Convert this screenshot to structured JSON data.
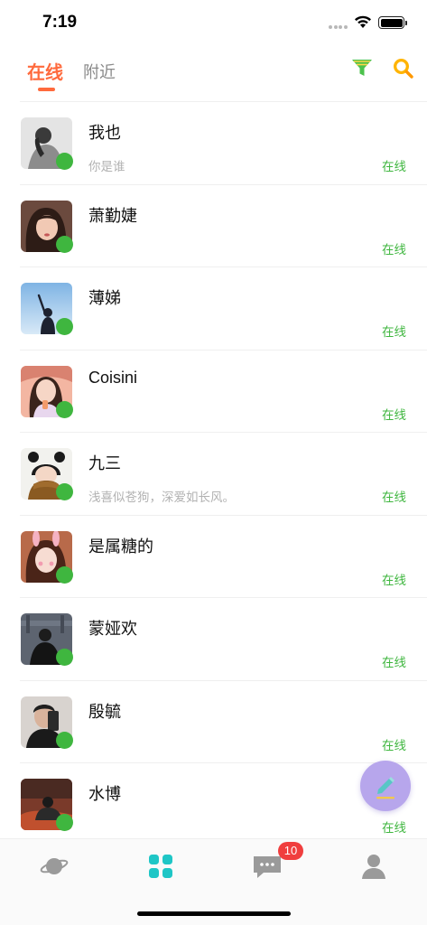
{
  "status_bar": {
    "time": "7:19"
  },
  "header": {
    "tabs": [
      {
        "label": "在线",
        "active": true
      },
      {
        "label": "附近",
        "active": false
      }
    ],
    "filter_icon": "funnel-icon",
    "search_icon": "search-icon",
    "accent": "#ff6a3d"
  },
  "users": [
    {
      "name": "我也",
      "bio": "你是谁",
      "status": "在线"
    },
    {
      "name": "萧勤婕",
      "bio": "",
      "status": "在线"
    },
    {
      "name": "薄娣",
      "bio": "",
      "status": "在线"
    },
    {
      "name": "Coisini",
      "bio": "",
      "status": "在线"
    },
    {
      "name": "九三",
      "bio": "浅喜似苍狗，深爱如长风。",
      "status": "在线"
    },
    {
      "name": "是属糖的",
      "bio": "",
      "status": "在线"
    },
    {
      "name": "蒙娅欢",
      "bio": "",
      "status": "在线"
    },
    {
      "name": "殷毓",
      "bio": "",
      "status": "在线"
    },
    {
      "name": "水博",
      "bio": "",
      "status": "在线"
    }
  ],
  "online_color": "#3fb63f",
  "fab": {
    "icon": "pencil-icon"
  },
  "bottom_nav": {
    "items": [
      {
        "icon": "planet-icon"
      },
      {
        "icon": "grid-icon",
        "active": true
      },
      {
        "icon": "message-icon",
        "badge": "10"
      },
      {
        "icon": "profile-icon"
      }
    ]
  }
}
